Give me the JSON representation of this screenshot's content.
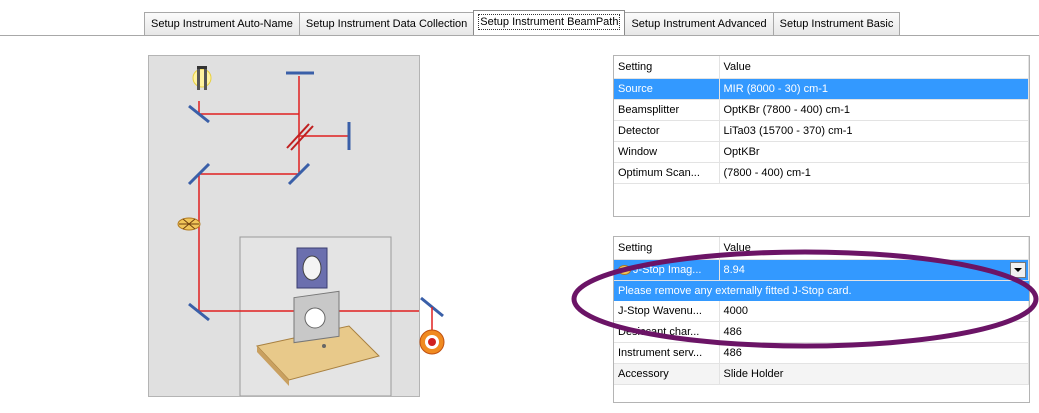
{
  "tabs": [
    {
      "label": "Setup Instrument Auto-Name"
    },
    {
      "label": "Setup Instrument Data Collection"
    },
    {
      "label": "Setup Instrument BeamPath"
    },
    {
      "label": "Setup Instrument Advanced"
    },
    {
      "label": "Setup Instrument Basic"
    }
  ],
  "grid1": {
    "headers": [
      "Setting",
      "Value"
    ],
    "rows": [
      {
        "setting": "Source",
        "value": "MIR (8000 - 30) cm-1"
      },
      {
        "setting": "Beamsplitter",
        "value": "OptKBr (7800 - 400) cm-1"
      },
      {
        "setting": "Detector",
        "value": "LiTa03 (15700 - 370) cm-1"
      },
      {
        "setting": "Window",
        "value": "OptKBr"
      },
      {
        "setting": "Optimum Scan...",
        "value": "(7800 - 400) cm-1"
      }
    ]
  },
  "grid2": {
    "headers": [
      "Setting",
      "Value"
    ],
    "selected": {
      "setting": "J-Stop Imag...",
      "value": "8.94"
    },
    "description": "Please remove any externally fitted J-Stop card.",
    "rows": [
      {
        "setting": "J-Stop Wavenu...",
        "value": "4000"
      },
      {
        "setting": "Desiccant char...",
        "value": "486"
      },
      {
        "setting": "Instrument serv...",
        "value": "486"
      },
      {
        "setting": "Accessory",
        "value": "Slide Holder"
      }
    ]
  },
  "colors": {
    "beam": "#e02020",
    "selection": "#3399ff",
    "annotation": "#6b1466",
    "mirror": "#3a5fa8"
  }
}
